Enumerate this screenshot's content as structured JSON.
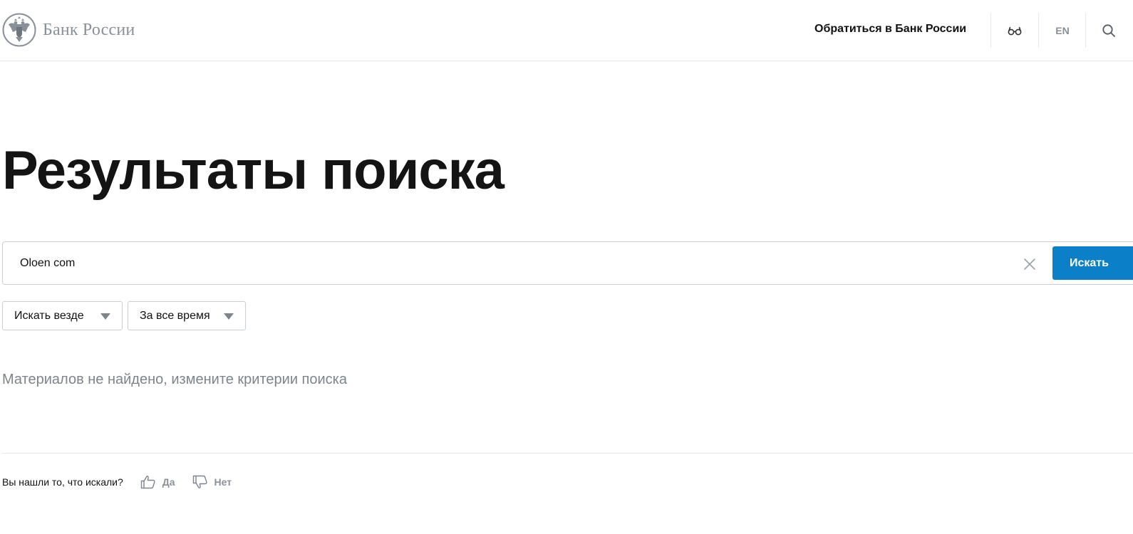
{
  "header": {
    "logo_text": "Банк России",
    "contact_link": "Обратиться в Банк России",
    "language": "EN",
    "icons": {
      "logo": "eagle-emblem-icon",
      "accessibility": "glasses-icon",
      "search": "search-icon"
    }
  },
  "page": {
    "title": "Результаты поиска"
  },
  "search": {
    "value": "Oloen com",
    "button_label": "Искать",
    "clear_icon": "close-icon"
  },
  "filters": {
    "scope": "Искать везде",
    "period": "За все время",
    "caret_icon": "caret-down-icon"
  },
  "results": {
    "empty_message": "Материалов не найдено, измените критерии поиска"
  },
  "feedback": {
    "question": "Вы нашли то, что искали?",
    "yes_label": "Да",
    "no_label": "Нет",
    "yes_icon": "thumbs-up-icon",
    "no_icon": "thumbs-down-icon"
  },
  "colors": {
    "accent": "#0b7fc7",
    "muted_text": "#8a9099",
    "border": "#c9ced4",
    "divider": "#e6e8eb"
  }
}
